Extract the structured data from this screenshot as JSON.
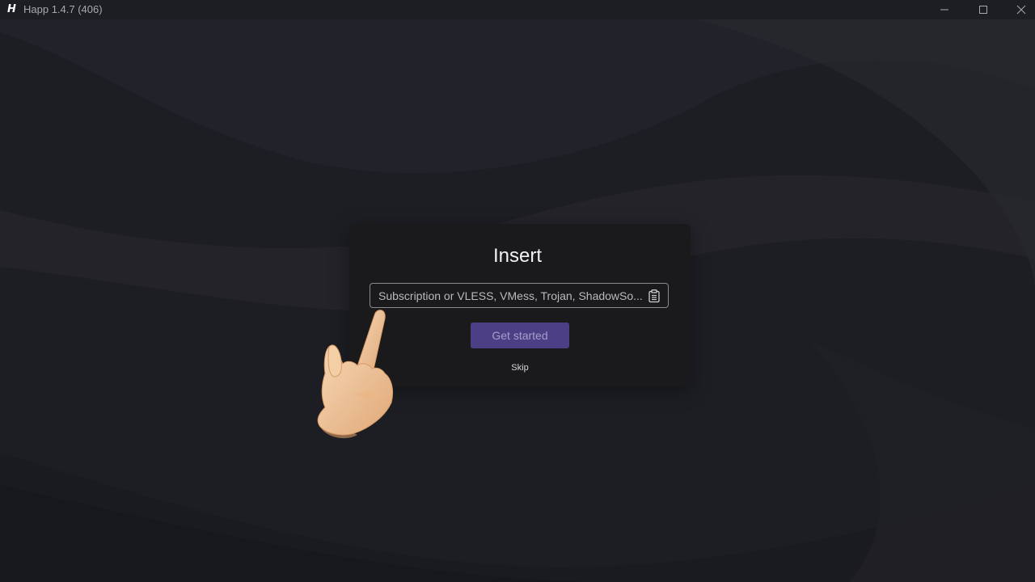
{
  "window": {
    "title": "Happ 1.4.7 (406)",
    "logo_letter": "H",
    "controls": [
      "minimize-icon",
      "maximize-icon",
      "close-icon"
    ]
  },
  "dialog": {
    "title": "Insert",
    "input": {
      "value": "",
      "placeholder": "Subscription or VLESS, VMess, Trojan, ShadowSo..."
    },
    "paste_icon": "clipboard-icon",
    "primary_button": "Get started",
    "skip_link": "Skip"
  },
  "overlay": {
    "pointer_icon": "pointing-hand-icon"
  },
  "colors": {
    "background": "#1d1e23",
    "dialog": "#1a1a1c",
    "accent": "#4c3f86",
    "accent_text": "#a59fc9",
    "text": "#f2f2f4"
  }
}
